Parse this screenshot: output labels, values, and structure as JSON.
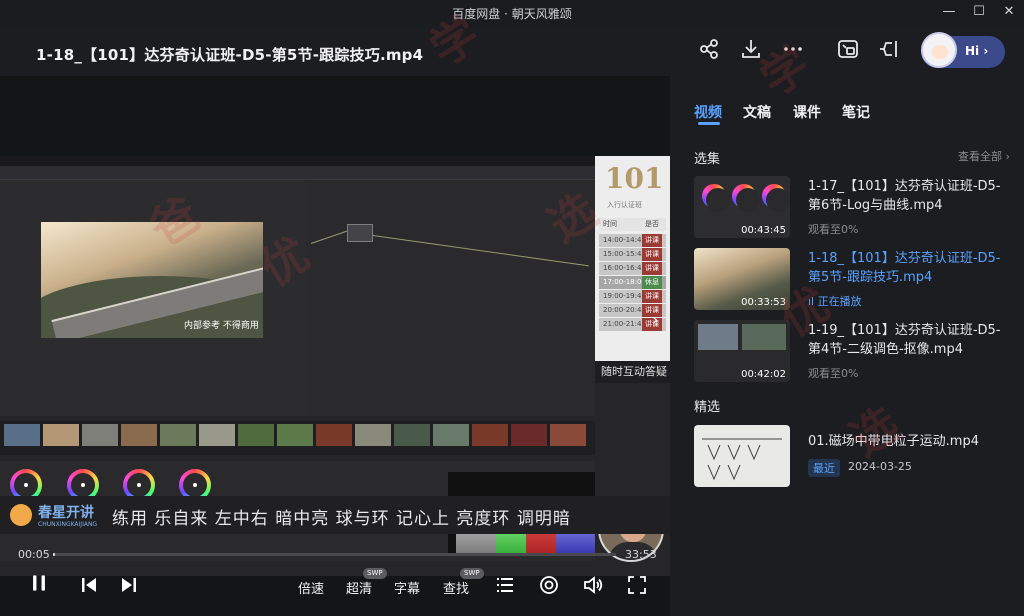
{
  "window": {
    "title": "百度网盘 · 朝天风雅颂",
    "minimize": "—",
    "maximize": "☐",
    "close": "✕"
  },
  "header": {
    "video_title": "1-18_【101】达芬奇认证班-D5-第5节-跟踪技巧.mp4",
    "icons": [
      "share-icon",
      "download-icon",
      "more-icon",
      "picture-in-picture-icon",
      "pin-icon"
    ],
    "hi_label": "Hi ›"
  },
  "video": {
    "viewer_caption": "内部参考 不得商用",
    "schedule": {
      "logo": "101",
      "subtitle": "入行认证班",
      "rows": [
        {
          "time": "时间",
          "status": "是否"
        },
        {
          "time": "14:00-14:45",
          "status": "讲课"
        },
        {
          "time": "15:00-15:45",
          "status": "讲课"
        },
        {
          "time": "16:00-16:45",
          "status": "讲课"
        },
        {
          "time": "17:00-18:00",
          "status": "休息"
        },
        {
          "time": "19:00-19:45",
          "status": "讲课"
        },
        {
          "time": "20:00-20:45",
          "status": "讲课"
        },
        {
          "time": "21:00-21:45",
          "status": "讲课"
        }
      ]
    },
    "interact_text": "随时互动答疑",
    "next_label": "›",
    "brand_name": "春星开讲",
    "brand_sub": "CHUNXINGKAIJIANG",
    "ticker": "练用 乐自来 左中右 暗中亮 球与环 记心上 亮度环 调明暗",
    "watermark": [
      "学",
      "爸",
      "优",
      "选"
    ]
  },
  "controls": {
    "current_time": "00:05",
    "total_time": "33:53",
    "progress_fraction": 0.0025,
    "speed_label": "倍速",
    "quality_label": "超清",
    "quality_badge": "SWP",
    "subtitle_label": "字幕",
    "search_label": "查找",
    "search_badge": "SWP",
    "icons": [
      "pause-icon",
      "previous-icon",
      "next-icon",
      "playlist-icon",
      "record-icon",
      "volume-icon",
      "fullscreen-icon"
    ]
  },
  "panel": {
    "tabs": [
      {
        "label": "视频",
        "active": true
      },
      {
        "label": "文稿",
        "active": false
      },
      {
        "label": "课件",
        "active": false
      },
      {
        "label": "笔记",
        "active": false
      }
    ],
    "episodes_title": "选集",
    "see_all": "查看全部 ›",
    "episodes": [
      {
        "title": "1-17_【101】达芬奇认证班-D5-第6节-Log与曲线.mp4",
        "duration": "00:43:45",
        "meta": "观看至0%",
        "active": false
      },
      {
        "title": "1-18_【101】达芬奇认证班-D5-第5节-跟踪技巧.mp4",
        "duration": "00:33:53",
        "meta": "正在播放",
        "active": true
      },
      {
        "title": "1-19_【101】达芬奇认证班-D5-第4节-二级调色-抠像.mp4",
        "duration": "00:42:02",
        "meta": "观看至0%",
        "active": false
      }
    ],
    "featured_title": "精选",
    "featured": {
      "title": "01.磁场中带电粒子运动.mp4",
      "tag": "最近",
      "date": "2024-03-25"
    }
  }
}
